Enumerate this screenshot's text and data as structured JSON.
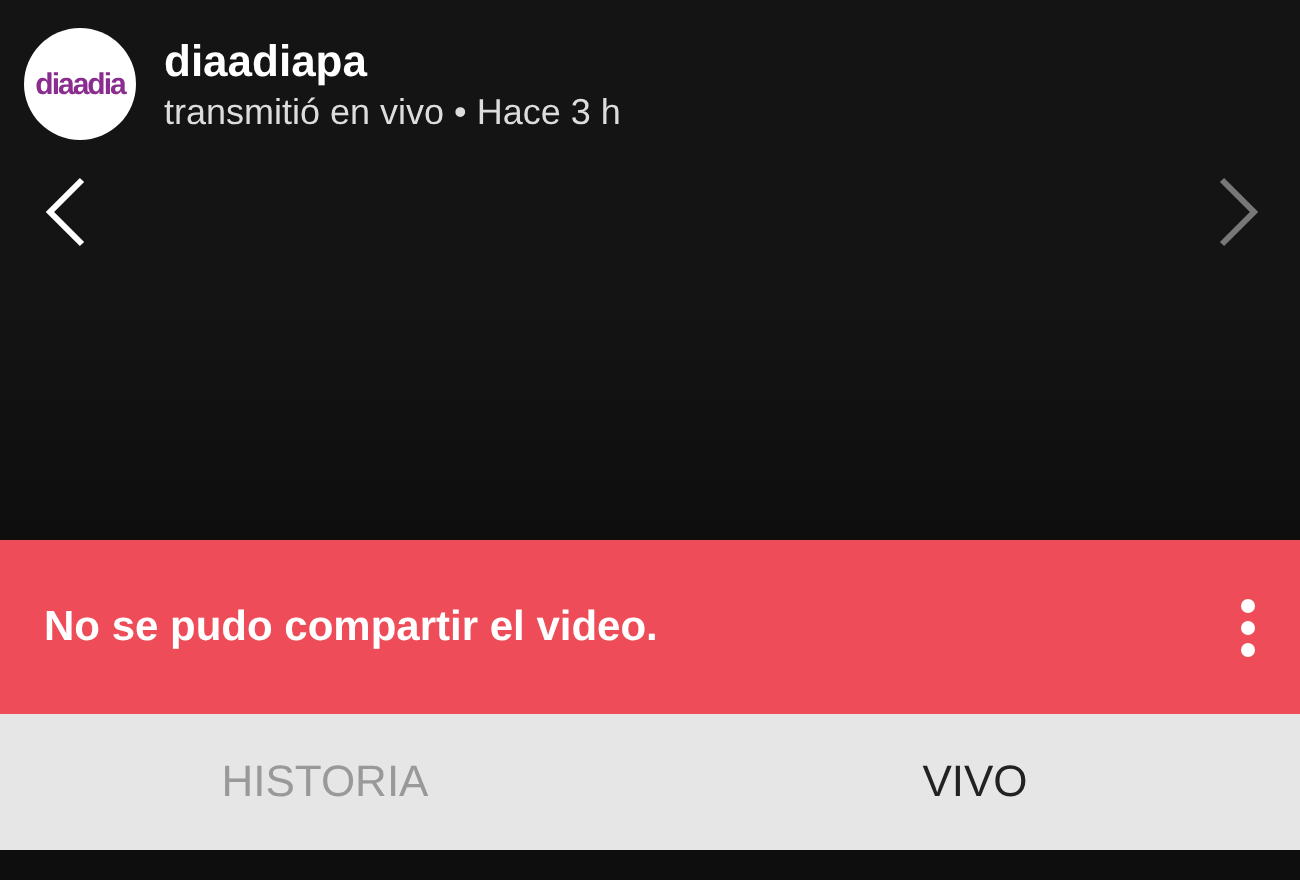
{
  "header": {
    "avatar_logo": "diaadia",
    "username": "diaadiapa",
    "subtitle": "transmitió en vivo • Hace 3 h"
  },
  "banner": {
    "message": "No se pudo compartir el video."
  },
  "tabs": [
    {
      "label": "HISTORIA",
      "selected": false
    },
    {
      "label": "VIVO",
      "selected": true
    }
  ]
}
